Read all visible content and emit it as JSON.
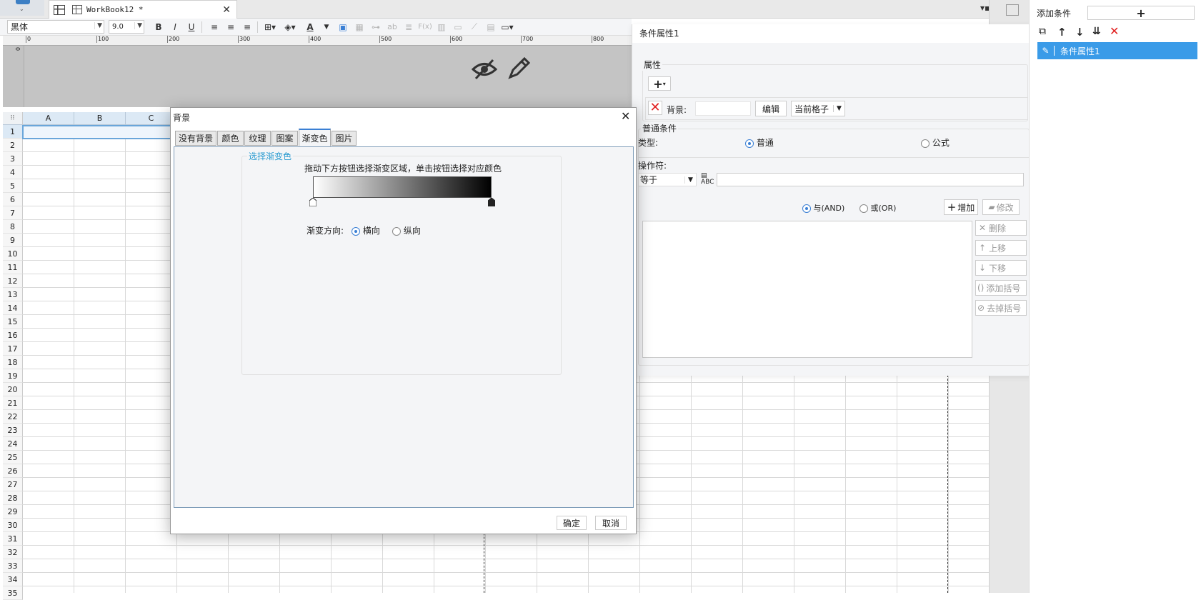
{
  "tabbar": {
    "workbook_tab": "WorkBook12 *"
  },
  "toolbar": {
    "font": "黑体",
    "size": "9.0",
    "bold": "B",
    "italic": "I",
    "underline": "U",
    "text_color": "A",
    "formula": "F(x)",
    "ab": "ab"
  },
  "ruler": {
    "ticks": [
      "0",
      "100",
      "200",
      "300",
      "400",
      "500",
      "600",
      "700",
      "800"
    ],
    "left_tick": "0"
  },
  "sheet": {
    "columns": [
      "A",
      "B",
      "C"
    ],
    "rows": [
      "1",
      "2",
      "3",
      "4",
      "5",
      "6",
      "7",
      "8",
      "9",
      "10",
      "11",
      "12",
      "13",
      "14",
      "15",
      "16",
      "17",
      "18",
      "19",
      "20",
      "21",
      "22",
      "23",
      "24",
      "25",
      "26",
      "27",
      "28",
      "29",
      "30",
      "31",
      "32",
      "33",
      "34",
      "35"
    ]
  },
  "dialog": {
    "title": "背景",
    "tabs": [
      "没有背景",
      "颜色",
      "纹理",
      "图案",
      "渐变色",
      "图片"
    ],
    "active_tab": "渐变色",
    "group_label": "选择渐变色",
    "hint": "拖动下方按钮选择渐变区域，单击按钮选择对应颜色",
    "direction_label": "渐变方向:",
    "horizontal": "横向",
    "vertical": "纵向",
    "ok": "确定",
    "cancel": "取消",
    "gradient_start": "#ffffff",
    "gradient_end": "#000000"
  },
  "cond_panel": {
    "title": "条件属性1",
    "attr_label": "属性",
    "bg_label": "背景:",
    "edit": "编辑",
    "scope": "当前格子",
    "normal_cond": "普通条件",
    "type_label": "类型:",
    "type_normal": "普通",
    "type_formula": "公式",
    "op_label": "操作符:",
    "op_value": "等于",
    "and": "与(AND)",
    "or": "或(OR)",
    "add": "增加",
    "modify": "修改",
    "delete": "删除",
    "up": "上移",
    "down": "下移",
    "add_bracket": "添加括号",
    "remove_bracket": "去掉括号"
  },
  "right_panel": {
    "add_condition": "添加条件",
    "add_btn": "+",
    "item": "条件属性1"
  }
}
